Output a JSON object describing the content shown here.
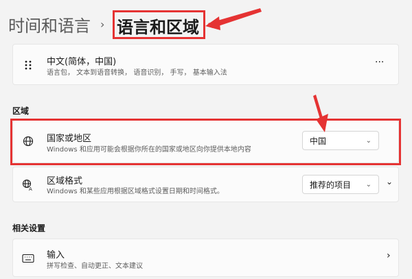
{
  "breadcrumb": {
    "parent": "时间和语言",
    "chevron": "›",
    "current": "语言和区域"
  },
  "language_item": {
    "title": "中文(简体，中国)",
    "subtitle": "语言包， 文本到语音转换， 语音识别， 手写， 基本输入法",
    "more_label": "···",
    "icon": "grip-dots-icon"
  },
  "region_section": {
    "heading": "区域",
    "country": {
      "title": "国家或地区",
      "subtitle": "Windows 和应用可能会根据你所在的国家或地区向你提供本地内容",
      "value": "中国",
      "icon": "globe-icon"
    },
    "format": {
      "title": "区域格式",
      "subtitle": "Windows 和某些应用根据区域格式设置日期和时间格式。",
      "value": "推荐的项目",
      "icon": "region-format-icon"
    }
  },
  "related_section": {
    "heading": "相关设置",
    "typing": {
      "title": "输入",
      "subtitle": "拼写检查、自动更正、文本建议",
      "icon": "keyboard-icon"
    }
  },
  "colors": {
    "annotation_red": "#e53333",
    "background": "#f3f3f3",
    "card": "#fbfbfb"
  }
}
